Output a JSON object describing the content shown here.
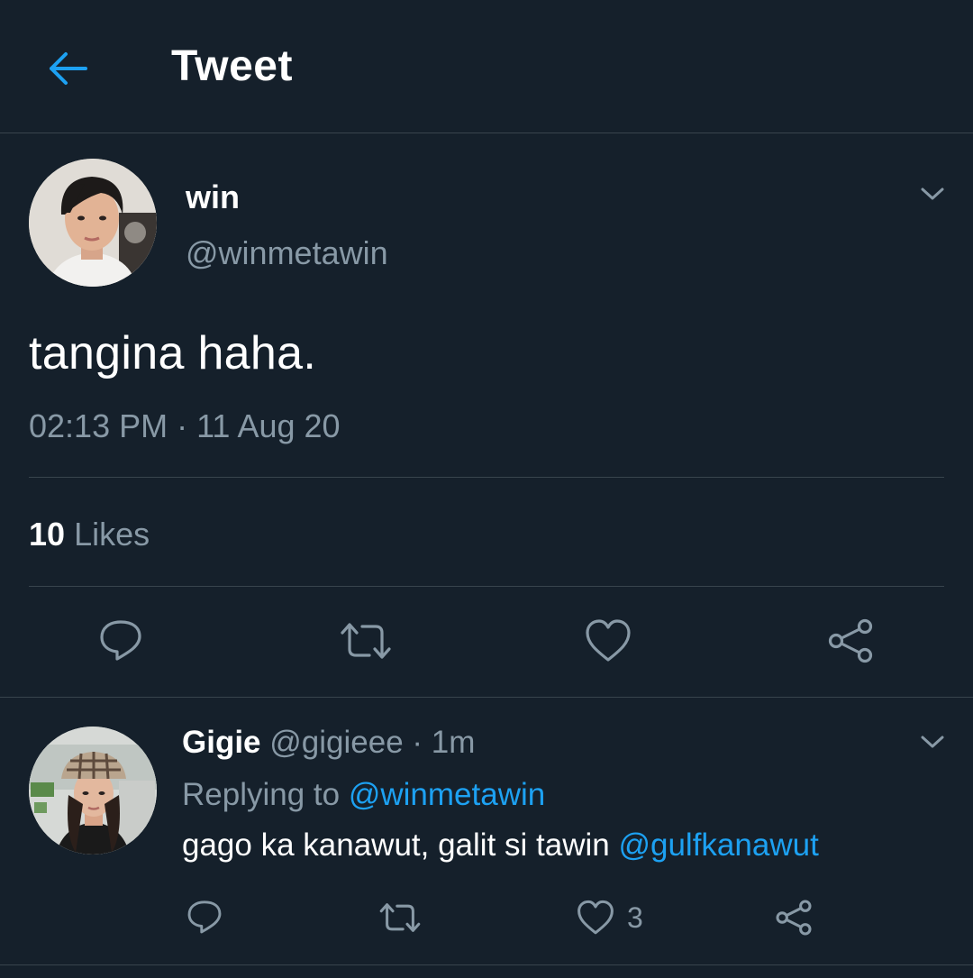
{
  "header": {
    "title": "Tweet",
    "back_icon": "arrow-left-icon",
    "accent": "#1da1f2"
  },
  "tweet": {
    "author_name": "win",
    "author_handle": "@winmetawin",
    "text": "tangina haha.",
    "timestamp": "02:13 PM · 11 Aug 20",
    "likes_count": "10",
    "likes_label": "Likes",
    "actions": [
      "reply-icon",
      "retweet-icon",
      "like-icon",
      "share-icon"
    ]
  },
  "reply": {
    "author_name": "Gigie",
    "author_handle": "@gigieee",
    "time": "· 1m",
    "replying_prefix": "Replying to",
    "replying_handle": "@winmetawin",
    "text": "gago ka kanawut, galit si tawin",
    "mention": "@gulfkanawut",
    "like_count": "3",
    "actions": [
      "reply-icon",
      "retweet-icon",
      "like-icon",
      "share-icon"
    ]
  },
  "colors": {
    "background": "#15202b",
    "secondary_text": "#8899a6",
    "divider": "#38444d",
    "link": "#1da1f2"
  }
}
